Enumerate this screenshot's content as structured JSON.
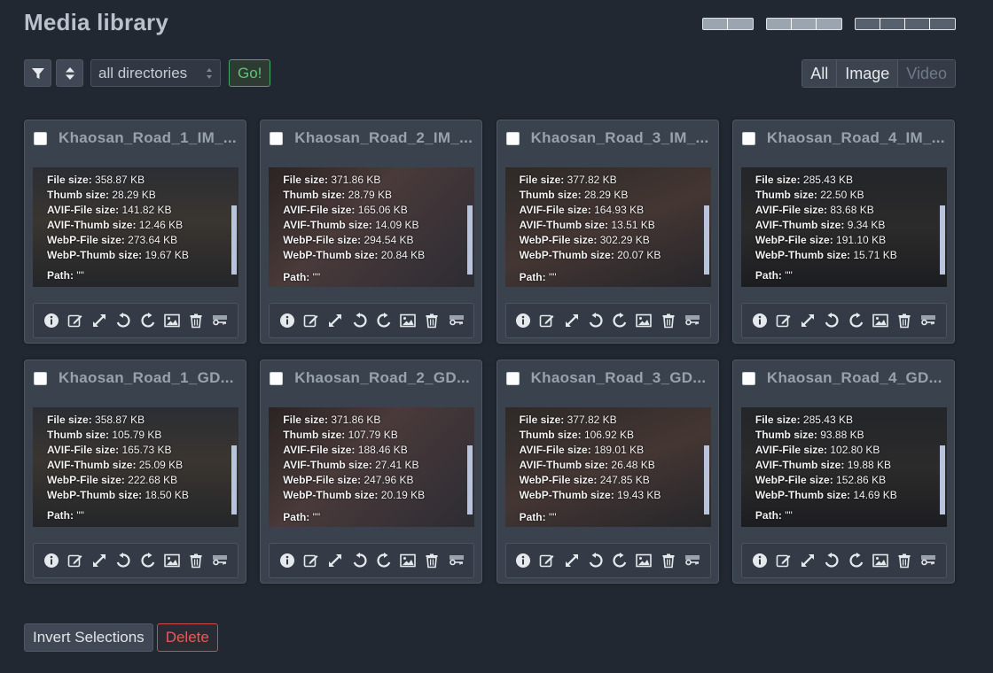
{
  "title": "Media library",
  "layout_toggles": [
    {
      "name": "layout-2-columns",
      "segments": 2
    },
    {
      "name": "layout-3-columns",
      "segments": 3
    },
    {
      "name": "layout-4-columns",
      "segments": 4,
      "selected": true
    }
  ],
  "filter": {
    "directory": "all directories",
    "go_label": "Go!"
  },
  "type_filter": [
    "All",
    "Image",
    "Video"
  ],
  "cards": [
    {
      "title": "Khaosan_Road_1_IM_...",
      "file_size": "358.87 KB",
      "thumb_size": "28.29 KB",
      "avif_file_size": "141.82 KB",
      "avif_thumb_size": "12.46 KB",
      "webp_file_size": "273.64 KB",
      "webp_thumb_size": "19.67 KB",
      "path": "\"\""
    },
    {
      "title": "Khaosan_Road_2_IM_...",
      "file_size": "371.86 KB",
      "thumb_size": "28.79 KB",
      "avif_file_size": "165.06 KB",
      "avif_thumb_size": "14.09 KB",
      "webp_file_size": "294.54 KB",
      "webp_thumb_size": "20.84 KB",
      "path": "\"\""
    },
    {
      "title": "Khaosan_Road_3_IM_...",
      "file_size": "377.82 KB",
      "thumb_size": "28.29 KB",
      "avif_file_size": "164.93 KB",
      "avif_thumb_size": "13.51 KB",
      "webp_file_size": "302.29 KB",
      "webp_thumb_size": "20.07 KB",
      "path": "\"\""
    },
    {
      "title": "Khaosan_Road_4_IM_...",
      "file_size": "285.43 KB",
      "thumb_size": "22.50 KB",
      "avif_file_size": "83.68 KB",
      "avif_thumb_size": "9.34 KB",
      "webp_file_size": "191.10 KB",
      "webp_thumb_size": "15.71 KB",
      "path": "\"\""
    },
    {
      "title": "Khaosan_Road_1_GD...",
      "file_size": "358.87 KB",
      "thumb_size": "105.79 KB",
      "avif_file_size": "165.73 KB",
      "avif_thumb_size": "25.09 KB",
      "webp_file_size": "222.68 KB",
      "webp_thumb_size": "18.50 KB",
      "path": "\"\""
    },
    {
      "title": "Khaosan_Road_2_GD...",
      "file_size": "371.86 KB",
      "thumb_size": "107.79 KB",
      "avif_file_size": "188.46 KB",
      "avif_thumb_size": "27.41 KB",
      "webp_file_size": "247.96 KB",
      "webp_thumb_size": "20.19 KB",
      "path": "\"\""
    },
    {
      "title": "Khaosan_Road_3_GD...",
      "file_size": "377.82 KB",
      "thumb_size": "106.92 KB",
      "avif_file_size": "189.01 KB",
      "avif_thumb_size": "26.48 KB",
      "webp_file_size": "247.85 KB",
      "webp_thumb_size": "19.43 KB",
      "path": "\"\""
    },
    {
      "title": "Khaosan_Road_4_GD...",
      "file_size": "285.43 KB",
      "thumb_size": "93.88 KB",
      "avif_file_size": "102.80 KB",
      "avif_thumb_size": "19.88 KB",
      "webp_file_size": "152.86 KB",
      "webp_thumb_size": "14.69 KB",
      "path": "\"\""
    }
  ],
  "labels": {
    "file_size": "File size:",
    "thumb_size": "Thumb size:",
    "avif_file_size": "AVIF-File size:",
    "avif_thumb_size": "AVIF-Thumb size:",
    "webp_file_size": "WebP-File size:",
    "webp_thumb_size": "WebP-Thumb size:",
    "path": "Path:"
  },
  "card_tools": [
    "info-icon",
    "edit-icon",
    "expand-icon",
    "rotate-left-icon",
    "rotate-right-icon",
    "image-icon",
    "trash-icon",
    "key-icon"
  ],
  "bottom": {
    "invert_label": "Invert Selections",
    "delete_label": "Delete"
  },
  "colors": {
    "background": "#222831",
    "card": "#3a424e",
    "go_green": "#5ec47b",
    "delete_red": "#e55b5b"
  }
}
